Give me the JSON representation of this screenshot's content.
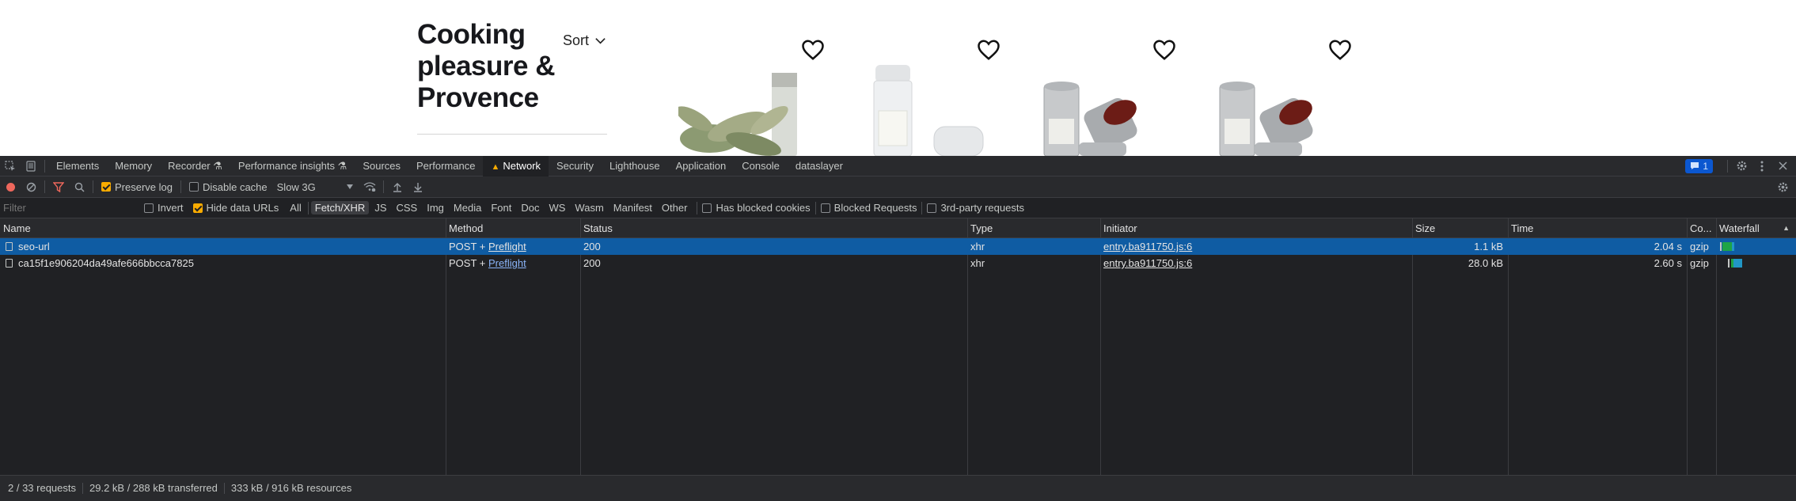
{
  "website": {
    "title_lines": [
      "Cooking",
      "pleasure &",
      "Provence"
    ],
    "sort_label": "Sort"
  },
  "devtools": {
    "tabs": [
      {
        "label": "Elements",
        "id": "elements"
      },
      {
        "label": "Memory",
        "id": "memory"
      },
      {
        "label": "Recorder",
        "id": "recorder"
      },
      {
        "label": "Performance insights",
        "id": "performance-insights"
      },
      {
        "label": "Sources",
        "id": "sources"
      },
      {
        "label": "Performance",
        "id": "performance"
      },
      {
        "label": "Network",
        "id": "network"
      },
      {
        "label": "Security",
        "id": "security"
      },
      {
        "label": "Lighthouse",
        "id": "lighthouse"
      },
      {
        "label": "Application",
        "id": "application"
      },
      {
        "label": "Console",
        "id": "console"
      },
      {
        "label": "dataslayer",
        "id": "dataslayer"
      }
    ],
    "active_tab": "Network",
    "issues_count": "1",
    "toolbar": {
      "preserve_log": "Preserve log",
      "disable_cache": "Disable cache",
      "throttling": "Slow 3G"
    },
    "filterbar": {
      "filter_placeholder": "Filter",
      "invert": "Invert",
      "hide_data_urls": "Hide data URLs",
      "types": [
        "All",
        "Fetch/XHR",
        "JS",
        "CSS",
        "Img",
        "Media",
        "Font",
        "Doc",
        "WS",
        "Wasm",
        "Manifest",
        "Other"
      ],
      "active_type": "Fetch/XHR",
      "has_blocked_cookies": "Has blocked cookies",
      "blocked_requests": "Blocked Requests",
      "third_party": "3rd-party requests"
    },
    "columns": {
      "name": "Name",
      "method": "Method",
      "status": "Status",
      "type": "Type",
      "initiator": "Initiator",
      "size": "Size",
      "time": "Time",
      "content_encoding": "Co...",
      "waterfall": "Waterfall"
    },
    "requests": [
      {
        "name": "seo-url",
        "method": "POST + ",
        "preflight": "Preflight",
        "status": "200",
        "type": "xhr",
        "initiator": "entry.ba911750.js:6",
        "size": "1.1 kB",
        "time": "2.04 s",
        "encoding": "gzip"
      },
      {
        "name": "ca15f1e906204da49afe666bbcca7825",
        "method": "POST + ",
        "preflight": "Preflight",
        "status": "200",
        "type": "xhr",
        "initiator": "entry.ba911750.js:6",
        "size": "28.0 kB",
        "time": "2.60 s",
        "encoding": "gzip"
      }
    ],
    "status": {
      "requests": "2 / 33 requests",
      "transferred": "29.2 kB / 288 kB transferred",
      "resources": "333 kB / 916 kB resources"
    },
    "colors": {
      "selected_row": "#0f5ca3",
      "warning": "#f9ab00",
      "waterfall_green": "#1ea446",
      "waterfall_teal": "#2196c6"
    }
  }
}
